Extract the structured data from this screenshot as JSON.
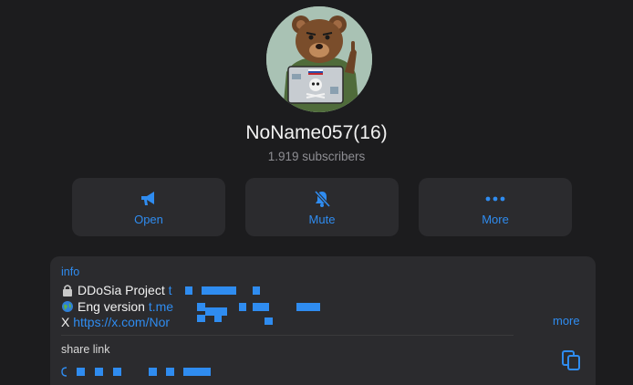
{
  "channel": {
    "name": "NoName057(16)",
    "subscribers": "1.919 subscribers"
  },
  "actions": {
    "open": {
      "label": "Open",
      "icon": "megaphone-icon"
    },
    "mute": {
      "label": "Mute",
      "icon": "bell-slash-icon"
    },
    "more": {
      "label": "More",
      "icon": "ellipsis-icon"
    }
  },
  "info": {
    "heading": "info",
    "lines": [
      {
        "prefix": "DDoSia Project",
        "link": "t"
      },
      {
        "prefix": "Eng version",
        "link": "t.me"
      },
      {
        "prefix": "X",
        "link": "https://x.com/Nor"
      }
    ],
    "more_label": "more"
  },
  "share": {
    "heading": "share link",
    "icon": "copy-icon"
  },
  "colors": {
    "background": "#1c1c1e",
    "card": "#2b2b2e",
    "accent": "#2f8cf0",
    "secondary_text": "#8e8e93"
  }
}
